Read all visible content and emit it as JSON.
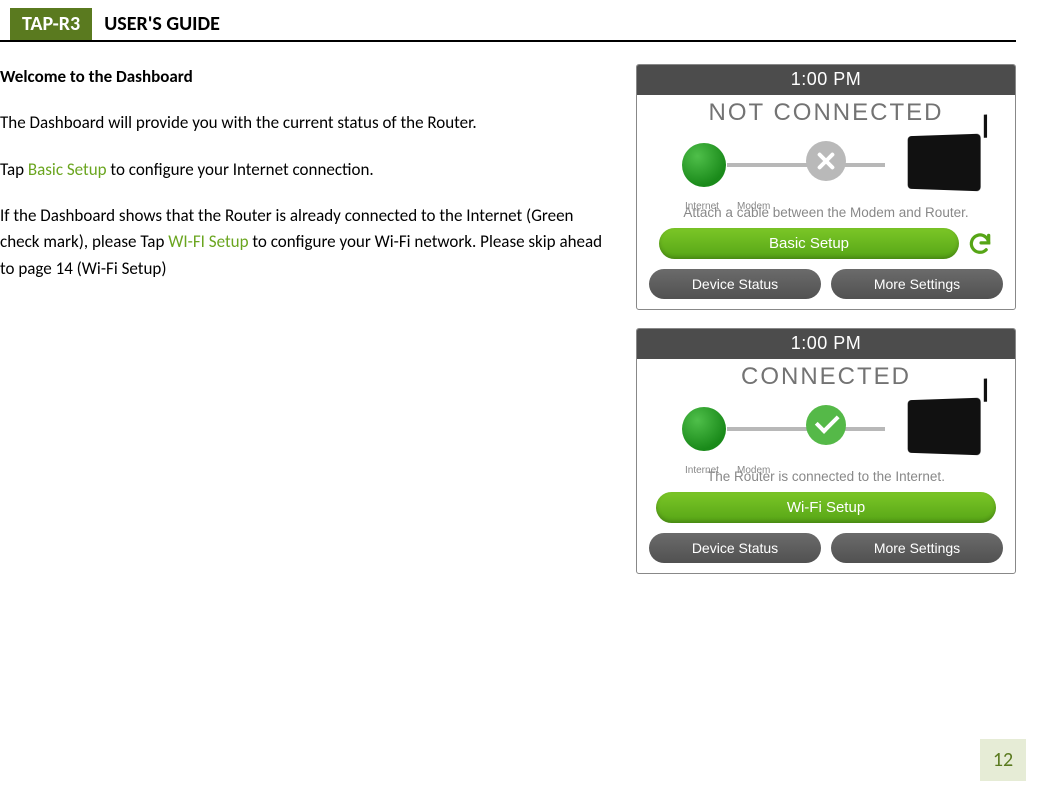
{
  "header": {
    "badge": "TAP-R3",
    "title": "USER'S GUIDE"
  },
  "body": {
    "heading": "Welcome to the Dashboard",
    "p1": "The Dashboard will provide you with the current status of the Router.",
    "p2_pre": "Tap ",
    "p2_link": "Basic Setup",
    "p2_post": " to configure your Internet connection.",
    "p3_pre": "If the Dashboard shows that the Router is already connected to the Internet (Green check mark), please Tap ",
    "p3_link": "WI-FI Setup",
    "p3_post": " to configure your Wi-Fi network.  Please skip ahead to page 14 (Wi-Fi Setup)"
  },
  "screen1": {
    "time": "1:00 PM",
    "status": "NOT CONNECTED",
    "label_internet": "Internet",
    "label_modem": "Modem",
    "caption": "Attach a cable between the Modem and Router.",
    "primary": "Basic Setup",
    "btn_left": "Device Status",
    "btn_right": "More Settings"
  },
  "screen2": {
    "time": "1:00 PM",
    "status": "CONNECTED",
    "label_internet": "Internet",
    "label_modem": "Modem",
    "caption": "The Router is connected to the Internet.",
    "primary": "Wi-Fi Setup",
    "btn_left": "Device Status",
    "btn_right": "More Settings"
  },
  "page_number": "12"
}
